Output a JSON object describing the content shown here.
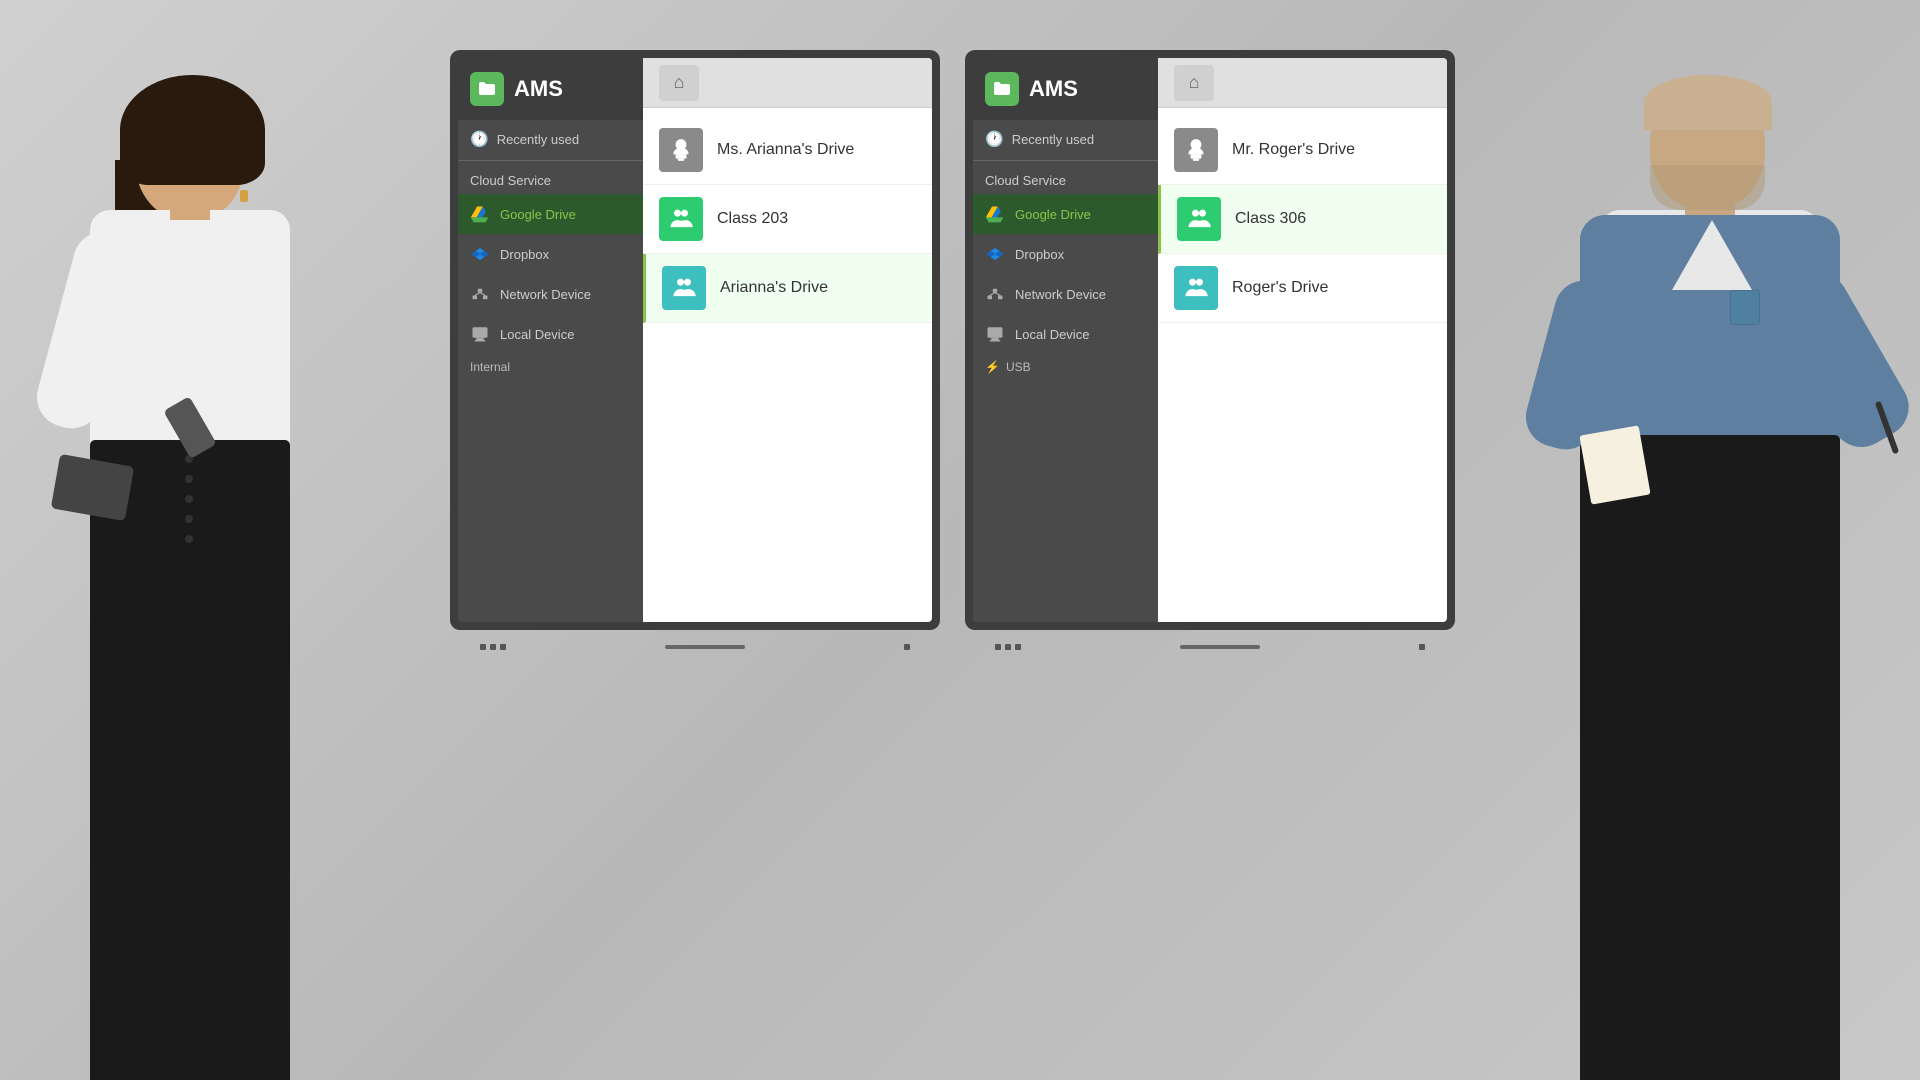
{
  "background_color": "#c2c2c2",
  "accent_color": "#8bc34a",
  "left_panel": {
    "monitor": {
      "title": "AMS",
      "sidebar": {
        "recently_used_label": "Recently used",
        "cloud_service_label": "Cloud Service",
        "google_drive_label": "Google Drive",
        "dropbox_label": "Dropbox",
        "network_device_label": "Network Device",
        "local_device_label": "Local Device",
        "internal_label": "Internal"
      },
      "files": [
        {
          "name": "Ms. Arianna's Drive",
          "type": "drive",
          "color": "gray",
          "selected": false
        },
        {
          "name": "Class 203",
          "type": "people",
          "color": "green",
          "selected": false
        },
        {
          "name": "Arianna's Drive",
          "type": "people",
          "color": "teal",
          "selected": true
        }
      ]
    }
  },
  "right_panel": {
    "monitor": {
      "title": "AMS",
      "sidebar": {
        "recently_used_label": "Recently used",
        "cloud_service_label": "Cloud Service",
        "google_drive_label": "Google Drive",
        "dropbox_label": "Dropbox",
        "network_device_label": "Network Device",
        "local_device_label": "Local Device",
        "usb_label": "USB"
      },
      "files": [
        {
          "name": "Mr. Roger's Drive",
          "type": "drive",
          "color": "gray",
          "selected": false
        },
        {
          "name": "Class 306",
          "type": "people",
          "color": "green",
          "selected": true
        },
        {
          "name": "Roger's Drive",
          "type": "people",
          "color": "teal",
          "selected": false
        }
      ]
    }
  }
}
